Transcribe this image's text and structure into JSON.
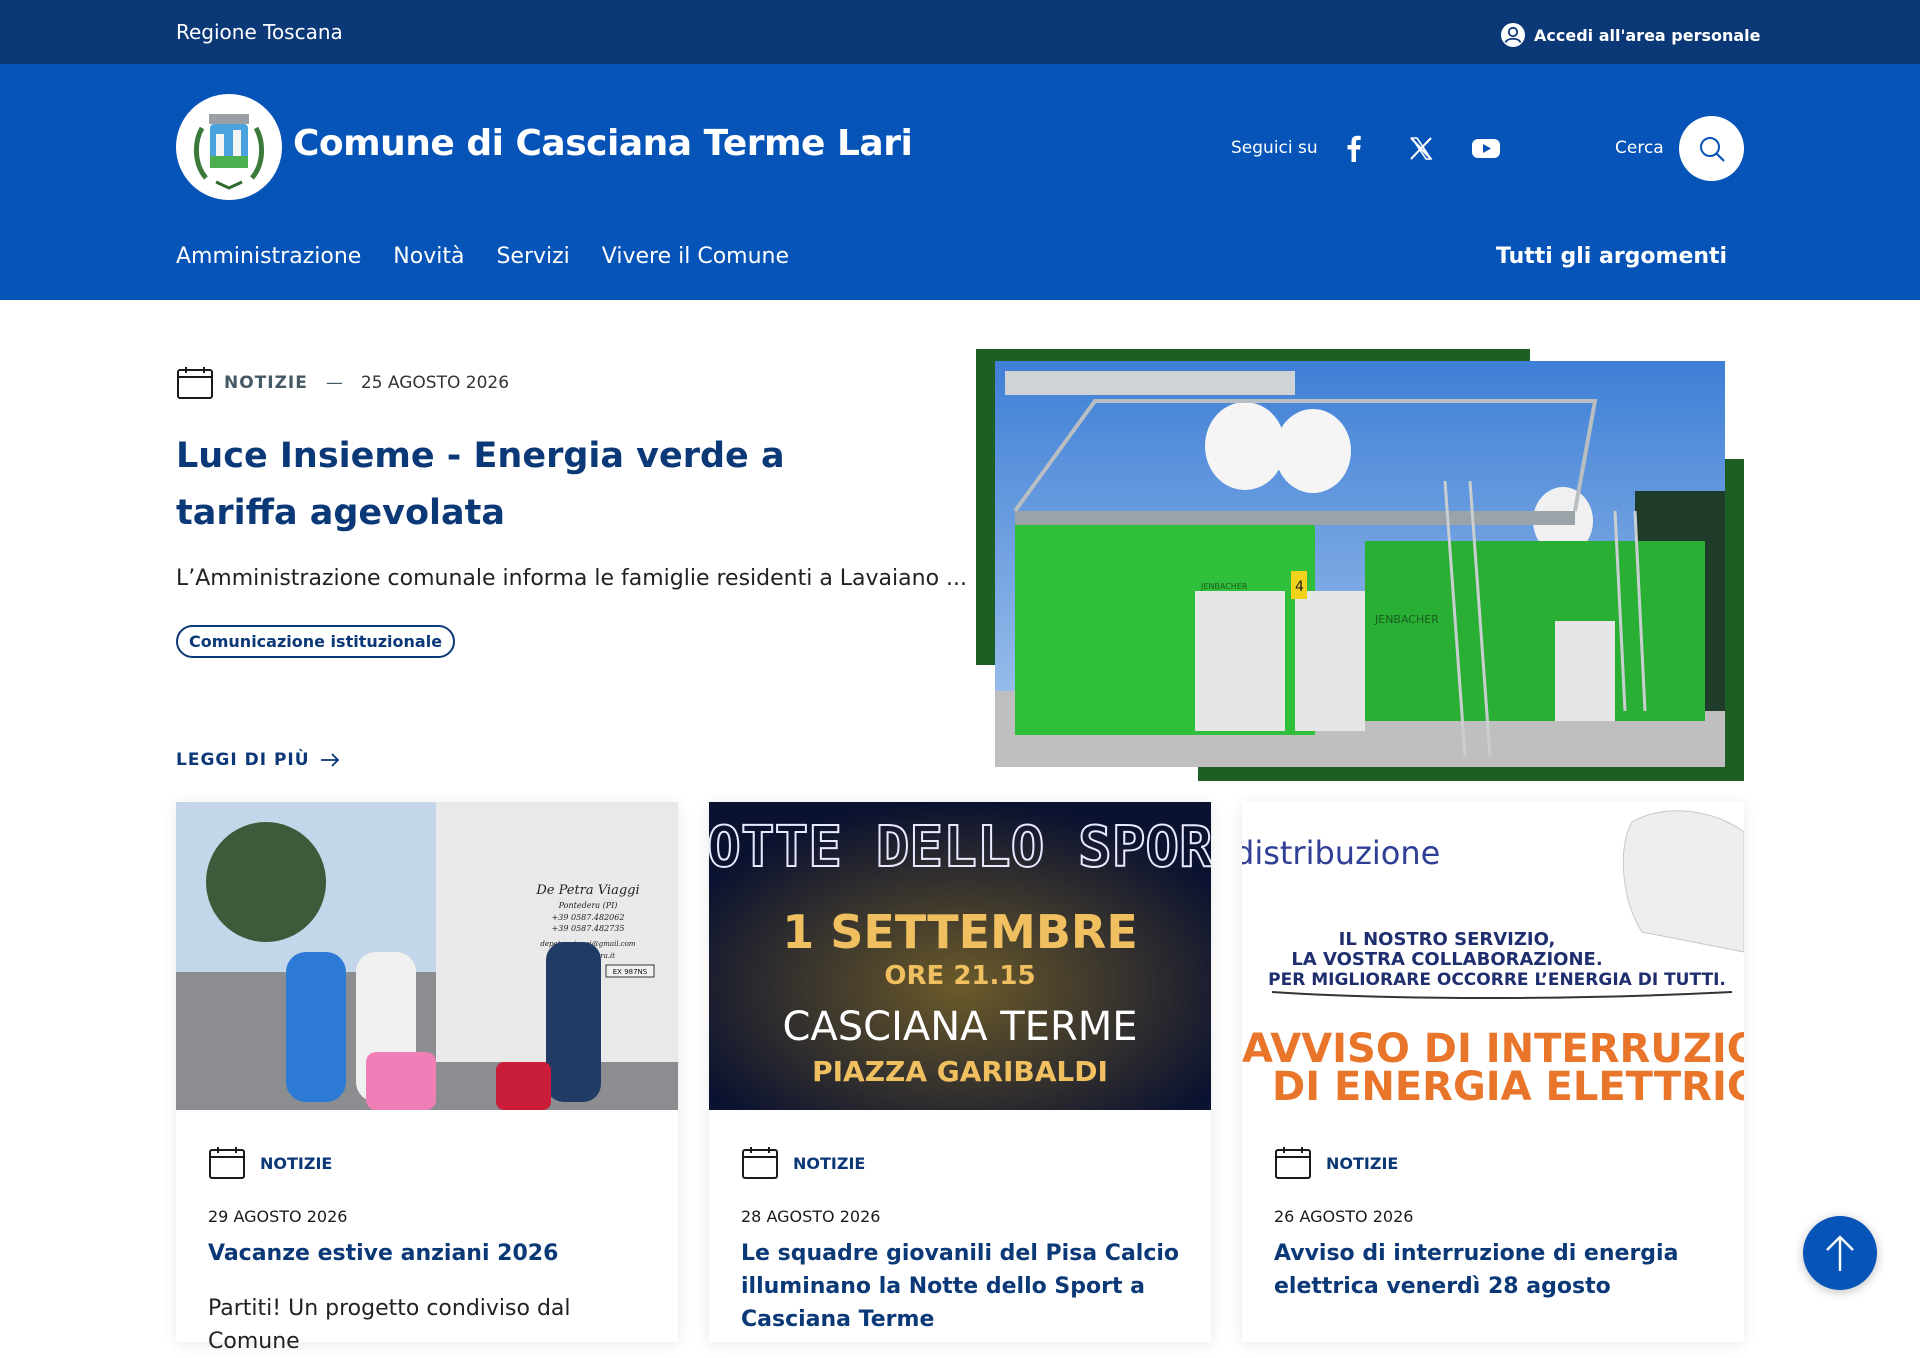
{
  "topbar": {
    "region": "Regione Toscana",
    "login_label": "Accedi all'area personale"
  },
  "header": {
    "site_title": "Comune di Casciana Terme Lari",
    "follow_label": "Seguici su",
    "search_label": "Cerca",
    "nav": [
      "Amministrazione",
      "Novità",
      "Servizi",
      "Vivere il Comune"
    ],
    "all_topics": "Tutti gli argomenti"
  },
  "hero": {
    "category": "NOTIZIE",
    "separator": "—",
    "date": "25 AGOSTO 2026",
    "title": "Luce Insieme - Energia verde a tariffa agevolata",
    "excerpt": "L’Amministrazione comunale informa le famiglie residenti a Lavaiano ...",
    "tag": "Comunicazione istituzionale",
    "read_more": "LEGGI DI PIÙ",
    "image_panel_labels": [
      "JENBACHER",
      "4",
      "JENBACHER"
    ]
  },
  "cards": [
    {
      "category": "NOTIZIE",
      "date": "29 AGOSTO 2026",
      "title": "Vacanze estive anziani 2026",
      "excerpt": "Partiti! Un progetto condiviso dal Comune",
      "image_bus_text": [
        "De Petra Viaggi",
        "Pontedera (PI)",
        "+39 0587.482062",
        "+39 0587.482735",
        "depetra.viaggi@gmail.com",
        "www.depetra.it"
      ],
      "image_plate": "EX 987NS"
    },
    {
      "category": "NOTIZIE",
      "date": "28 AGOSTO 2026",
      "title": "Le squadre giovanili del Pisa Calcio illuminano la Notte dello Sport a Casciana Terme",
      "excerpt": "",
      "image_text": {
        "neon": "OTTE DELLO SPOR",
        "date": "1 SETTEMBRE",
        "time": "ORE 21.15",
        "place": "CASCIANA TERME",
        "square": "PIAZZA GARIBALDI"
      }
    },
    {
      "category": "NOTIZIE",
      "date": "26 AGOSTO 2026",
      "title": "Avviso di interruzione di energia elettrica venerdì 28 agosto",
      "excerpt": "",
      "image_text": {
        "top": "distribuzione",
        "line1": "IL NOSTRO SERVIZIO,",
        "line2": "LA VOSTRA COLLABORAZIONE.",
        "line3": "PER MIGLIORARE OCCORRE L’ENERGIA DI TUTTI.",
        "headline1": "AVVISO DI INTERRUZIONE",
        "headline2": "DI ENERGIA ELETTRICA"
      }
    }
  ],
  "colors": {
    "topbar": "#0b3877",
    "header": "#0754b8",
    "title_text": "#0b3877",
    "hero_frame": "#1d5e24"
  },
  "icons": [
    "user-circle-icon",
    "facebook-icon",
    "x-icon",
    "youtube-icon",
    "search-icon",
    "calendar-icon",
    "arrow-right-icon",
    "arrow-up-icon"
  ]
}
